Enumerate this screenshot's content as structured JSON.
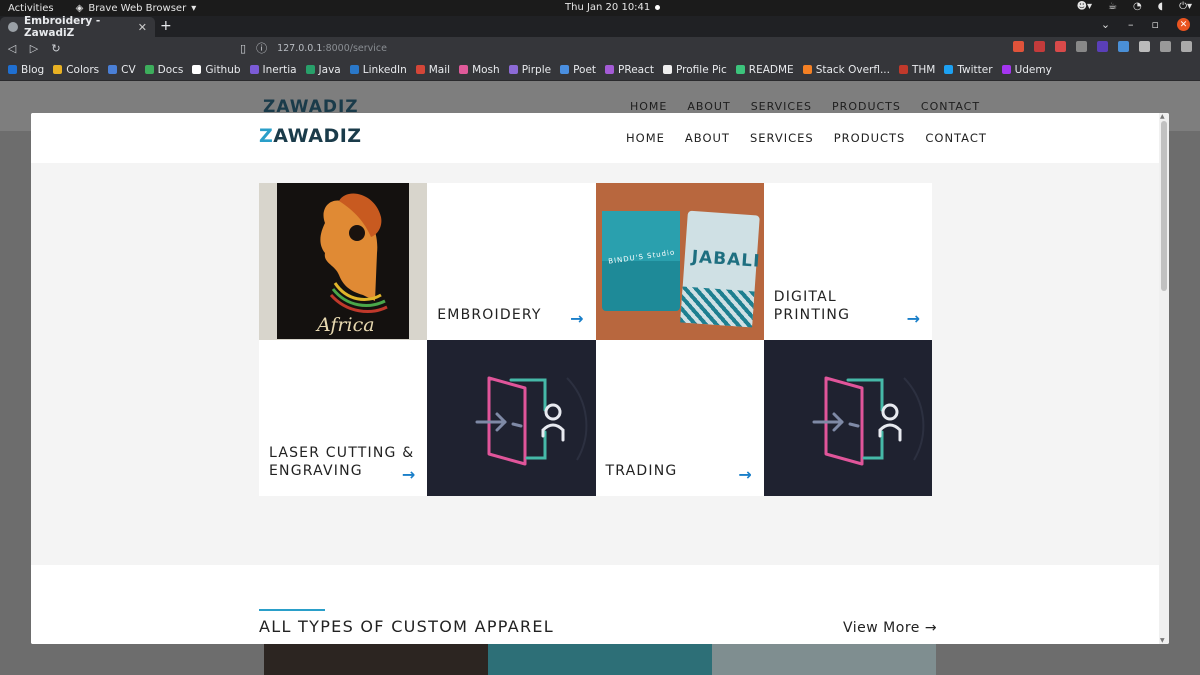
{
  "gnome": {
    "activities": "Activities",
    "app_name": "Brave Web Browser",
    "clock": "Thu Jan 20  10:41"
  },
  "browser": {
    "tab_title": "Embroidery - ZawadiZ",
    "url_host": "127.0.0.1",
    "url_path": ":8000/service",
    "bookmarks": [
      {
        "label": "Blog",
        "color": "#1f6fd1"
      },
      {
        "label": "Colors",
        "color": "#e8b123"
      },
      {
        "label": "CV",
        "color": "#4a7fd6"
      },
      {
        "label": "Docs",
        "color": "#3dae5c"
      },
      {
        "label": "Github",
        "color": "#ffffff"
      },
      {
        "label": "Inertia",
        "color": "#7b5bd6"
      },
      {
        "label": "Java",
        "color": "#28a06a"
      },
      {
        "label": "LinkedIn",
        "color": "#2a78c9"
      },
      {
        "label": "Mail",
        "color": "#d44638"
      },
      {
        "label": "Mosh",
        "color": "#e05a9a"
      },
      {
        "label": "Pirple",
        "color": "#8c6ad6"
      },
      {
        "label": "Poet",
        "color": "#4a8fe0"
      },
      {
        "label": "PReact",
        "color": "#a45bd6"
      },
      {
        "label": "Profile Pic",
        "color": "#eeeeee"
      },
      {
        "label": "README",
        "color": "#3cc47c"
      },
      {
        "label": "Stack Overfl...",
        "color": "#f48024"
      },
      {
        "label": "THM",
        "color": "#c0392b"
      },
      {
        "label": "Twitter",
        "color": "#1da1f2"
      },
      {
        "label": "Udemy",
        "color": "#a435f0"
      }
    ]
  },
  "site": {
    "logo_z": "Z",
    "logo_rest": "AWADIZ",
    "nav": [
      "HOME",
      "ABOUT",
      "SERVICES",
      "PRODUCTS",
      "CONTACT"
    ],
    "tiles": {
      "embroidery": "EMBROIDERY",
      "digital": "DIGITAL PRINTING",
      "laser": "LASER CUTTING & ENGRAVING",
      "trading": "TRADING",
      "arrow": "→",
      "africa_word": "Africa",
      "bag1_text": "BINDU'S Studio",
      "bag2_text": "JABALI"
    },
    "section2": {
      "title": "ALL TYPES OF CUSTOM APPAREL",
      "view_more": "View More →"
    }
  }
}
